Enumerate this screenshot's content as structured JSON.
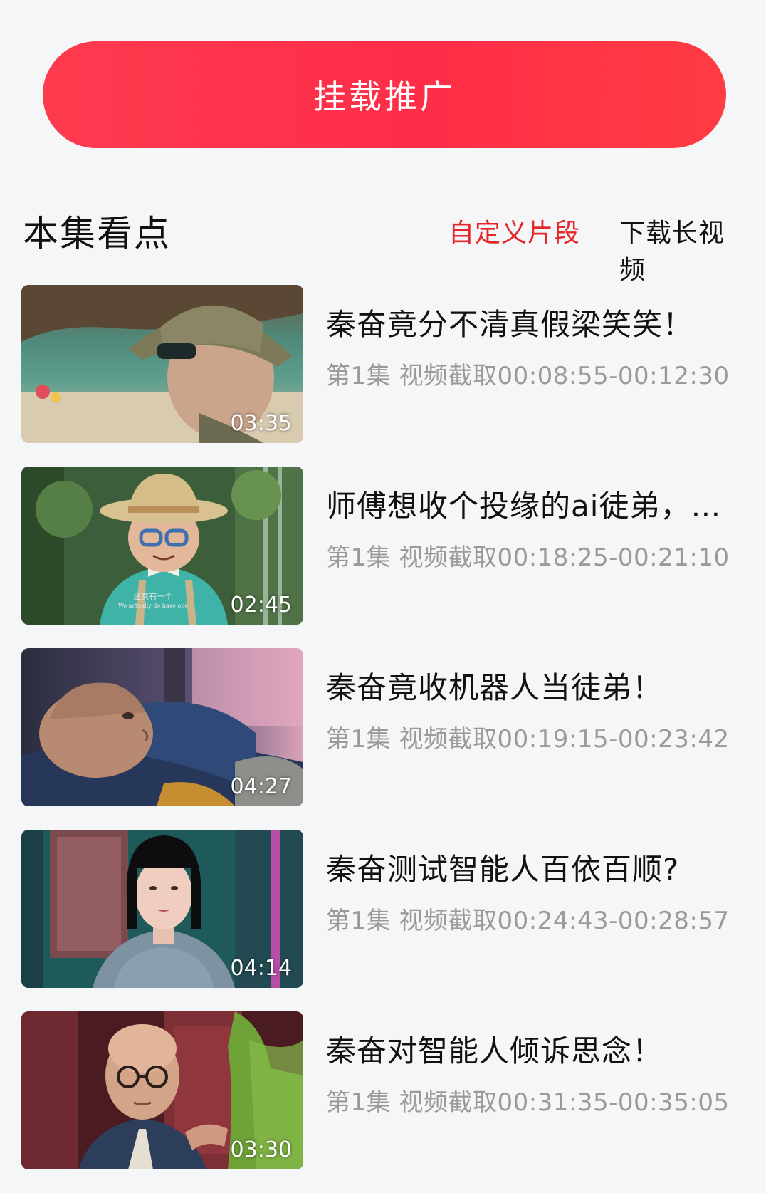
{
  "promo_button": {
    "label": "挂载推广"
  },
  "section": {
    "title": "本集看点",
    "custom_clip_label": "自定义片段",
    "download_long_label": "下载长视频"
  },
  "clips": [
    {
      "title": "秦奋竟分不清真假梁笑笑！",
      "meta": "第1集  视频截取00:08:55-00:12:30",
      "duration": "03:35",
      "thumb_icon": "man-with-bucket-hat-thumbnail"
    },
    {
      "title": "师傅想收个投缘的ai徒弟，…",
      "meta": "第1集  视频截取00:18:25-00:21:10",
      "duration": "02:45",
      "thumb_icon": "man-with-straw-hat-thumbnail",
      "subtitle_cn": "还真有一个",
      "subtitle_en": "We actually do have one"
    },
    {
      "title": "秦奋竟收机器人当徒弟！",
      "meta": "第1集  视频截取00:19:15-00:23:42",
      "duration": "04:27",
      "thumb_icon": "man-lying-on-sofa-thumbnail"
    },
    {
      "title": "秦奋测试智能人百依百顺?",
      "meta": "第1集  视频截取00:24:43-00:28:57",
      "duration": "04:14",
      "thumb_icon": "robot-woman-thumbnail"
    },
    {
      "title": "秦奋对智能人倾诉思念！",
      "meta": "第1集  视频截取00:31:35-00:35:05",
      "duration": "03:30",
      "thumb_icon": "bald-man-glasses-thumbnail"
    }
  ],
  "colors": {
    "accent_red": "#e5262a",
    "button_red": "#ff2d48",
    "background": "#f5f6f8",
    "meta_gray": "#9a9a9a"
  }
}
